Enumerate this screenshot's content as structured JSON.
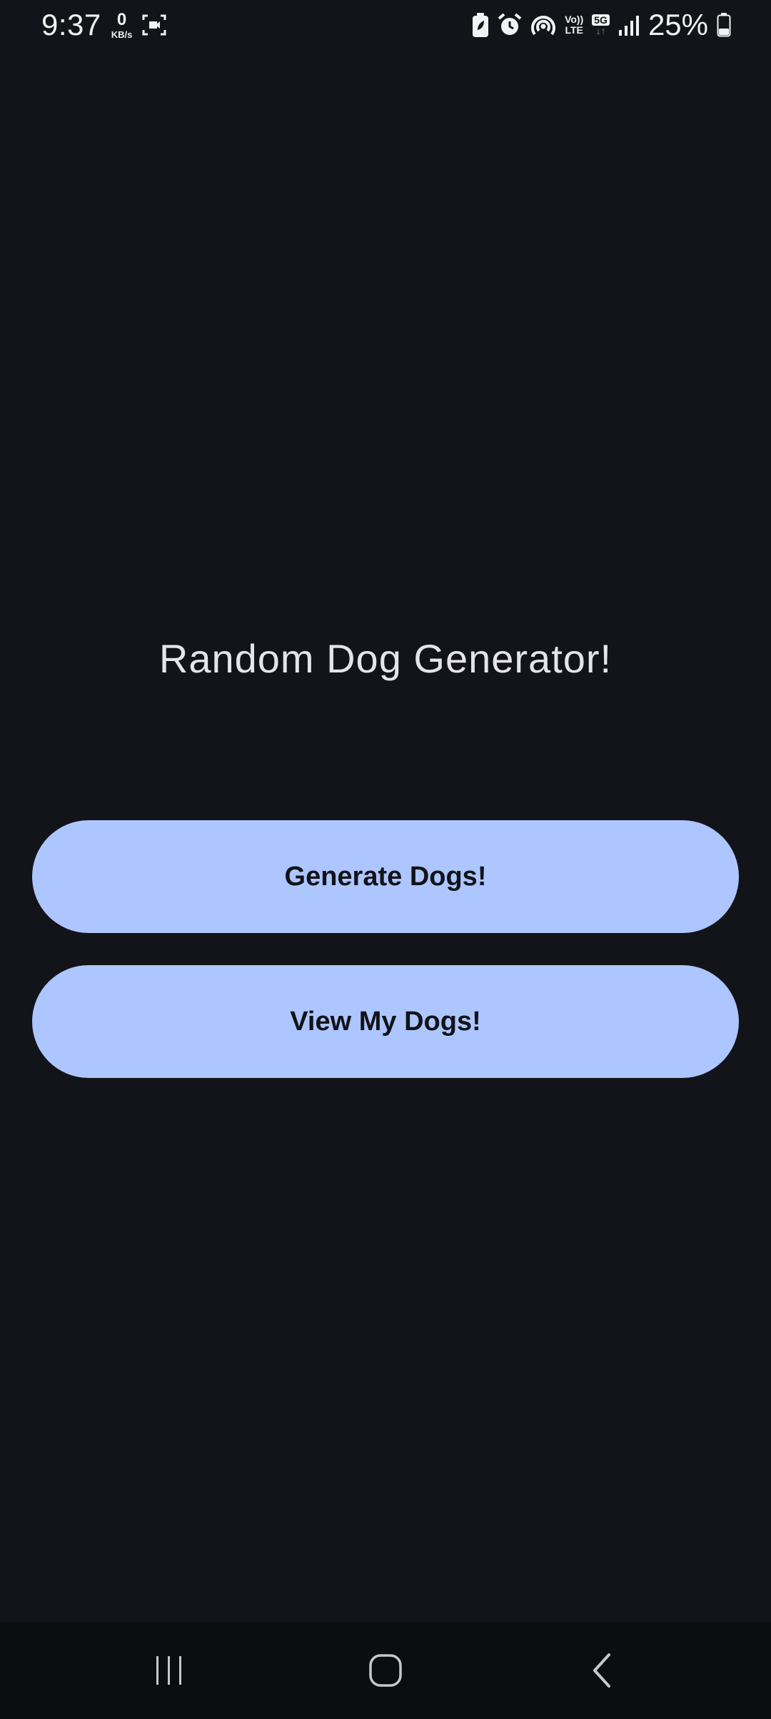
{
  "status_bar": {
    "time": "9:37",
    "net_speed_value": "0",
    "net_speed_unit": "KB/s",
    "volte_top": "Vo))",
    "volte_bottom": "LTE",
    "network_badge": "5G",
    "network_arrows": "↓↑",
    "battery_percent": "25%",
    "icons": [
      "screen-record-icon",
      "battery-saver-icon",
      "alarm-icon",
      "hotspot-icon",
      "volte-icon",
      "5g-icon",
      "signal-icon",
      "battery-icon"
    ]
  },
  "main": {
    "title": "Random Dog Generator!",
    "generate_button_label": "Generate Dogs!",
    "view_button_label": "View My Dogs!"
  },
  "nav_bar": {
    "buttons": [
      "recents",
      "home",
      "back"
    ]
  },
  "colors": {
    "background": "#131419",
    "button_fill": "#adc6ff",
    "button_text": "#111318",
    "title_text": "#e4e4ea",
    "nav_background": "#0c0d0f"
  }
}
